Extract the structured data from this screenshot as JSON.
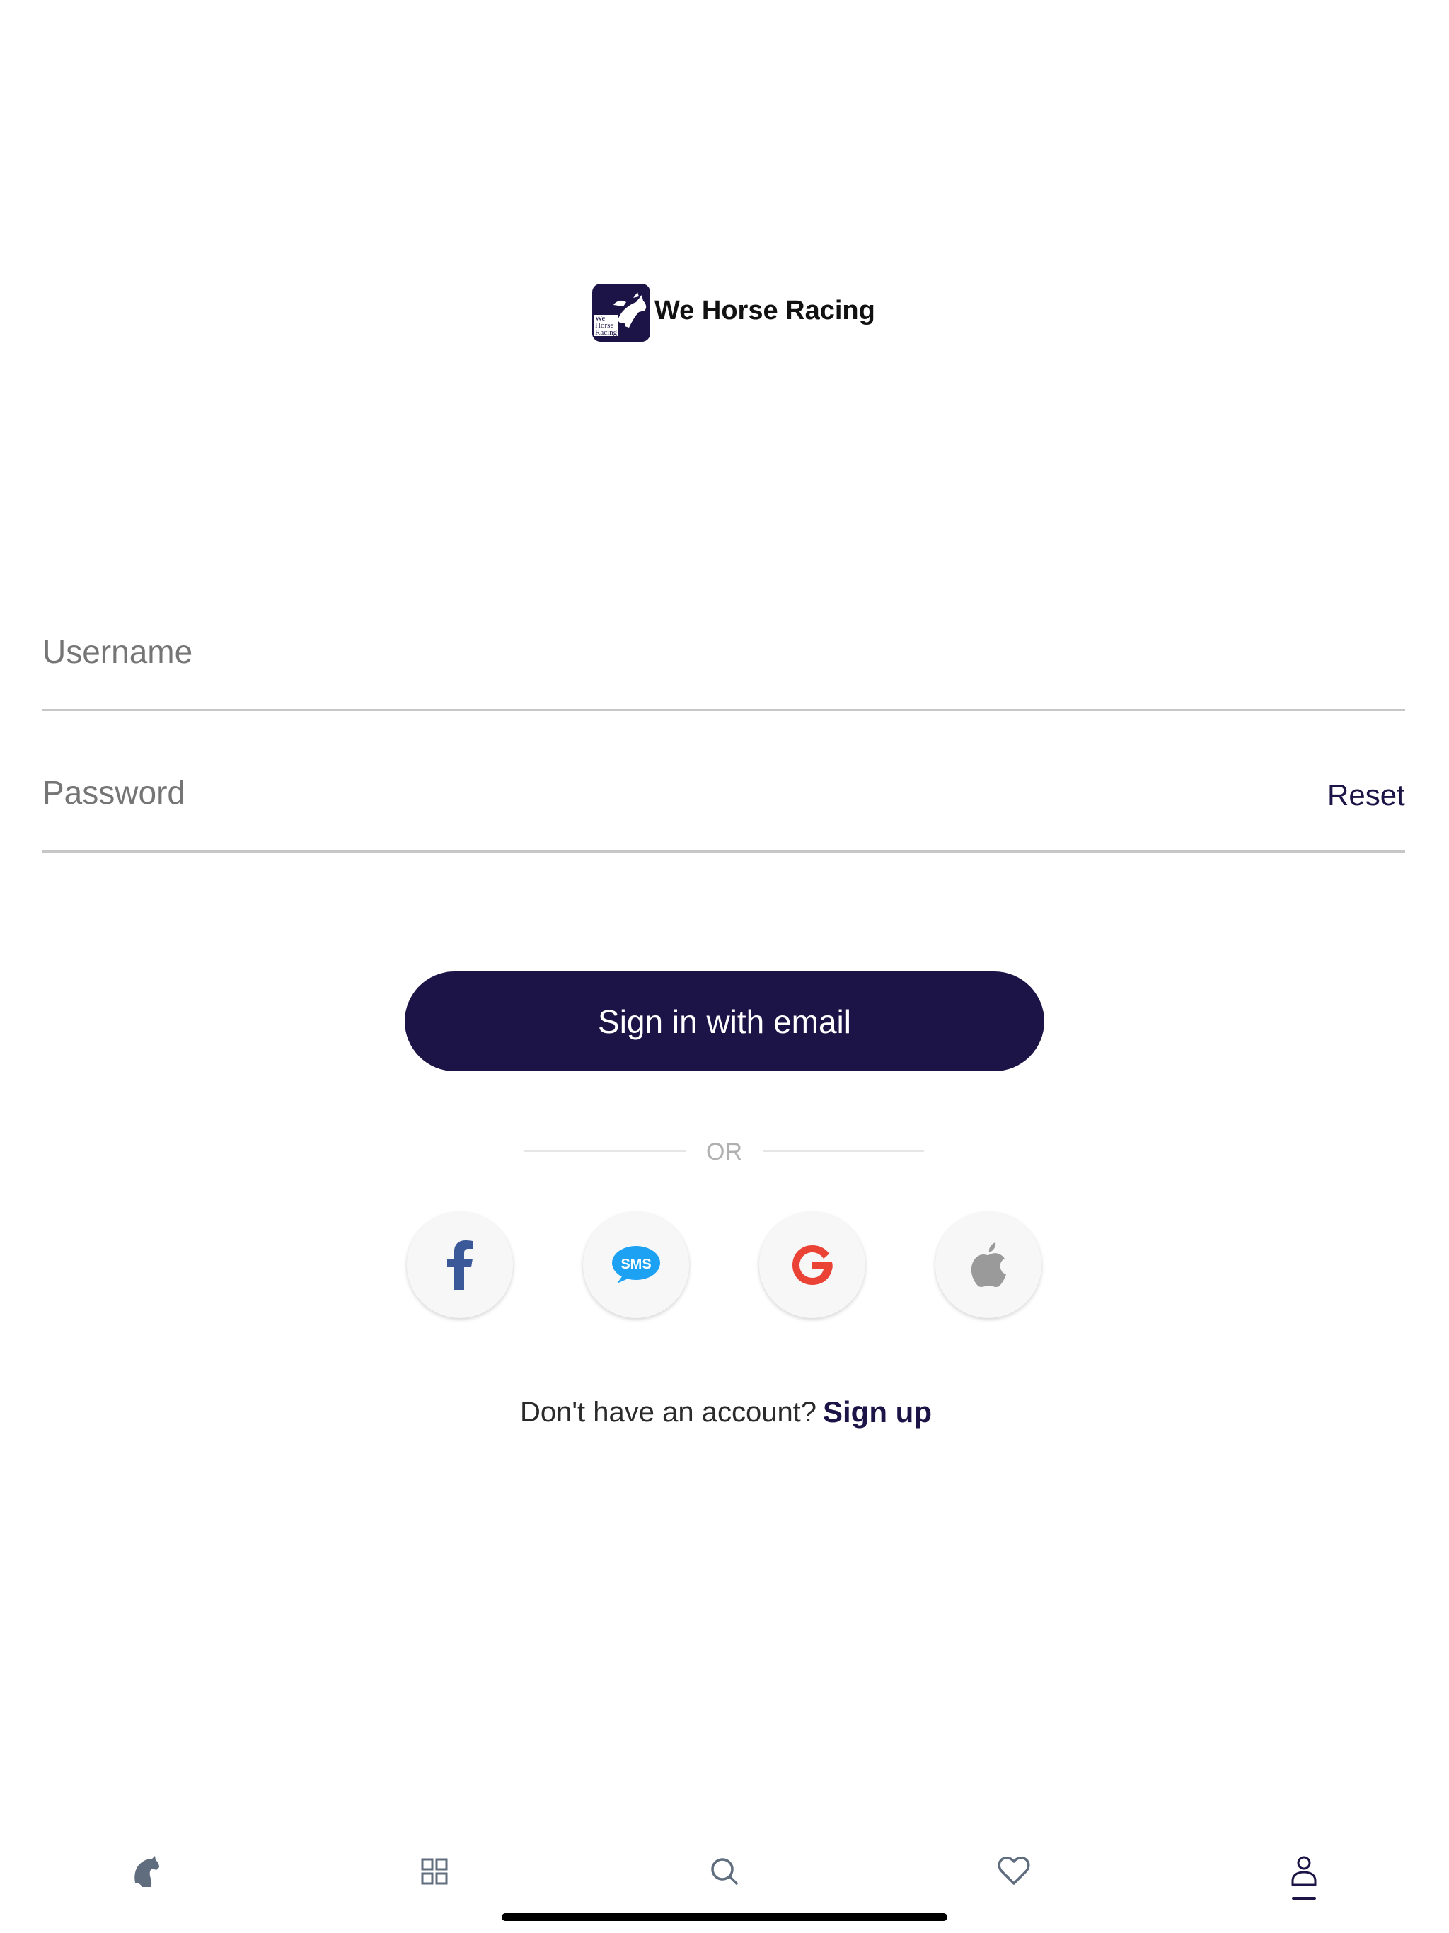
{
  "brand": {
    "name": "We Horse Racing",
    "logo_small_text": "We\nHorse\nRacing"
  },
  "form": {
    "username_placeholder": "Username",
    "password_placeholder": "Password",
    "reset_label": "Reset",
    "signin_label": "Sign in with email",
    "or_label": "OR"
  },
  "social": [
    {
      "name": "facebook",
      "icon": "facebook-icon",
      "color": "#3b5998"
    },
    {
      "name": "sms",
      "icon": "sms-icon",
      "label": "SMS",
      "color": "#1da1f2"
    },
    {
      "name": "google",
      "icon": "google-icon",
      "color": "#ea4335"
    },
    {
      "name": "apple",
      "icon": "apple-icon",
      "color": "#9a9a9a"
    }
  ],
  "signup": {
    "prompt": "Don't have an account?",
    "link_label": "Sign up"
  },
  "tabbar": {
    "items": [
      {
        "name": "home",
        "icon": "horse-head-icon"
      },
      {
        "name": "browse",
        "icon": "grid-icon"
      },
      {
        "name": "search",
        "icon": "search-icon"
      },
      {
        "name": "favorites",
        "icon": "heart-icon"
      },
      {
        "name": "profile",
        "icon": "person-icon",
        "active": true
      }
    ]
  },
  "colors": {
    "brand_primary": "#1c1446",
    "placeholder": "#b5b5b5",
    "divider": "#c7c7c7"
  }
}
